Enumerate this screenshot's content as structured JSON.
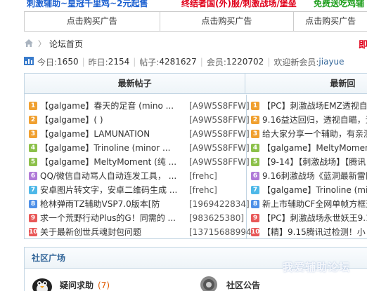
{
  "banner": {
    "link1": "刺激辅助~皇冠千里鸡~2元起售",
    "link2": "终结者国(外)服/刺激战场/堡垒",
    "link3": "免费送吃鸡辅"
  },
  "ads": [
    "点击购买广告",
    "点击购买广告",
    "点击购买广告"
  ],
  "breadcrumb": {
    "home": "论坛首页"
  },
  "corner_char": "即",
  "stats": {
    "today_label": "今日:",
    "today": "1650",
    "yesterday_label": "昨日:",
    "yesterday": "2154",
    "posts_label": "帖子:",
    "posts": "4281627",
    "members_label": "会员:",
    "members": "1220702",
    "newest_label": "欢迎新会员:",
    "newest": "jiayue"
  },
  "latest_posts": {
    "heading": "最新帖子",
    "rows": [
      {
        "num": "1",
        "title": "【galgame】春天的足音 (mino ...",
        "author": "[A9W5S8FFW]"
      },
      {
        "num": "2",
        "title": "【galgame】( )",
        "author": "[A9W5S8FFW]"
      },
      {
        "num": "3",
        "title": "【galgame】LAMUNATION",
        "author": "[A9W5S8FFW]"
      },
      {
        "num": "4",
        "title": "【galgame】Trinoline (minor ...",
        "author": "[A9W5S8FFW]"
      },
      {
        "num": "5",
        "title": "【galgame】MeltyMoment (纯 ...",
        "author": "[A9W5S8FFW]"
      },
      {
        "num": "6",
        "title": "QQ/微信自动骂人自动连发工具，  ...",
        "author": "[frehc]"
      },
      {
        "num": "7",
        "title": "安卓图片转文字，安卓二维码生成 ...",
        "author": "[frehc]"
      },
      {
        "num": "8",
        "title": "枪林弹雨TZ辅助VSP7.0版本[防",
        "author": "[1969422834]"
      },
      {
        "num": "9",
        "title": "求一个荒野行动Plus的G！同需的 ...",
        "author": "[983625380]"
      },
      {
        "num": "10",
        "title": "关于最新创世兵魂封包问题",
        "author": "[13715688994]"
      }
    ]
  },
  "latest_replies": {
    "heading": "最新回",
    "rows": [
      {
        "num": "1",
        "title": "【PC】刺激战场EMZ透视自"
      },
      {
        "num": "2",
        "title": "9.16益达回归，透视自瞄，无"
      },
      {
        "num": "3",
        "title": "给大家分享一个辅助，有亲测"
      },
      {
        "num": "4",
        "title": "【galgame】MeltyMoment (纯"
      },
      {
        "num": "5",
        "title": "【9-14】【刺激战场】【腾讯"
      },
      {
        "num": "6",
        "title": "9.16刺激战场《蓝洞最新雷区"
      },
      {
        "num": "7",
        "title": "【galgame】Trinoline (minor"
      },
      {
        "num": "8",
        "title": "新上市辅助CF全网单帧方框透"
      },
      {
        "num": "9",
        "title": "【PC】刺激战场永世妖王9.1"
      },
      {
        "num": "10",
        "title": "【精】9.15腾讯过检测！小"
      }
    ]
  },
  "community": {
    "heading": "社区广场",
    "forum1": {
      "name": "疑问求助",
      "count": "(7)"
    },
    "forum2": {
      "name": "社区公告"
    }
  },
  "watermark": "我爱辅助论坛"
}
